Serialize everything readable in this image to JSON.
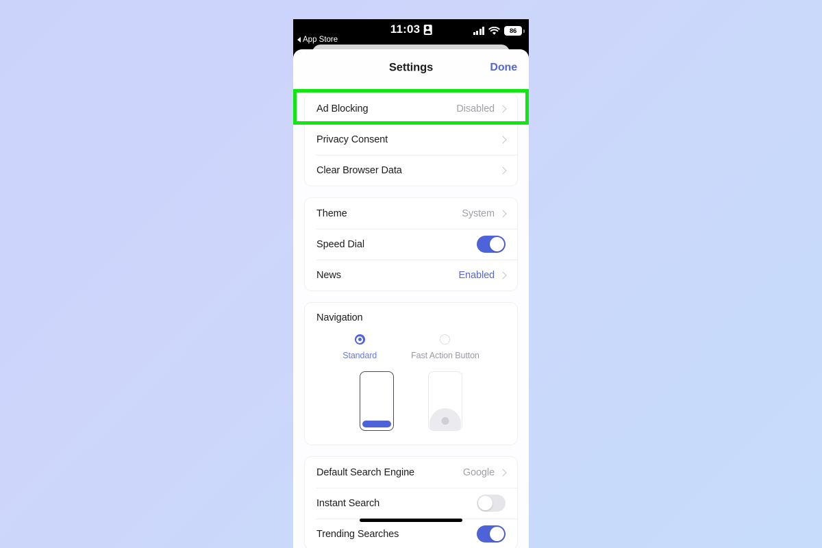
{
  "status_bar": {
    "time": "11:03",
    "recording_icon": "record-indicator-icon",
    "back_label": "App Store",
    "signal_icon": "cellular-signal-icon",
    "wifi_icon": "wifi-icon",
    "battery_level": "86"
  },
  "sheet": {
    "title": "Settings",
    "done_label": "Done"
  },
  "sections": [
    {
      "rows": [
        {
          "label": "Ad Blocking",
          "value": "Disabled",
          "type": "chevron",
          "highlighted": true
        },
        {
          "label": "Privacy Consent",
          "value": "",
          "type": "chevron"
        },
        {
          "label": "Clear Browser Data",
          "value": "",
          "type": "chevron"
        }
      ]
    },
    {
      "rows": [
        {
          "label": "Theme",
          "value": "System",
          "type": "chevron"
        },
        {
          "label": "Speed Dial",
          "value": "",
          "type": "toggle",
          "toggle_on": true
        },
        {
          "label": "News",
          "value": "Enabled",
          "type": "chevron",
          "accent": true
        }
      ]
    }
  ],
  "navigation": {
    "title": "Navigation",
    "options": [
      {
        "label": "Standard",
        "selected": true
      },
      {
        "label": "Fast Action Button",
        "selected": false
      }
    ]
  },
  "search_section": {
    "rows": [
      {
        "label": "Default Search Engine",
        "value": "Google",
        "type": "chevron"
      },
      {
        "label": "Instant Search",
        "value": "",
        "type": "toggle",
        "toggle_on": false
      },
      {
        "label": "Trending Searches",
        "value": "",
        "type": "toggle",
        "toggle_on": true
      }
    ]
  },
  "colors": {
    "accent_blue": "#4f63d8",
    "link_blue": "#5566d6",
    "highlight_green": "#12e512",
    "value_gray": "#a0a0a8",
    "page_background": "#ccd3fb"
  }
}
